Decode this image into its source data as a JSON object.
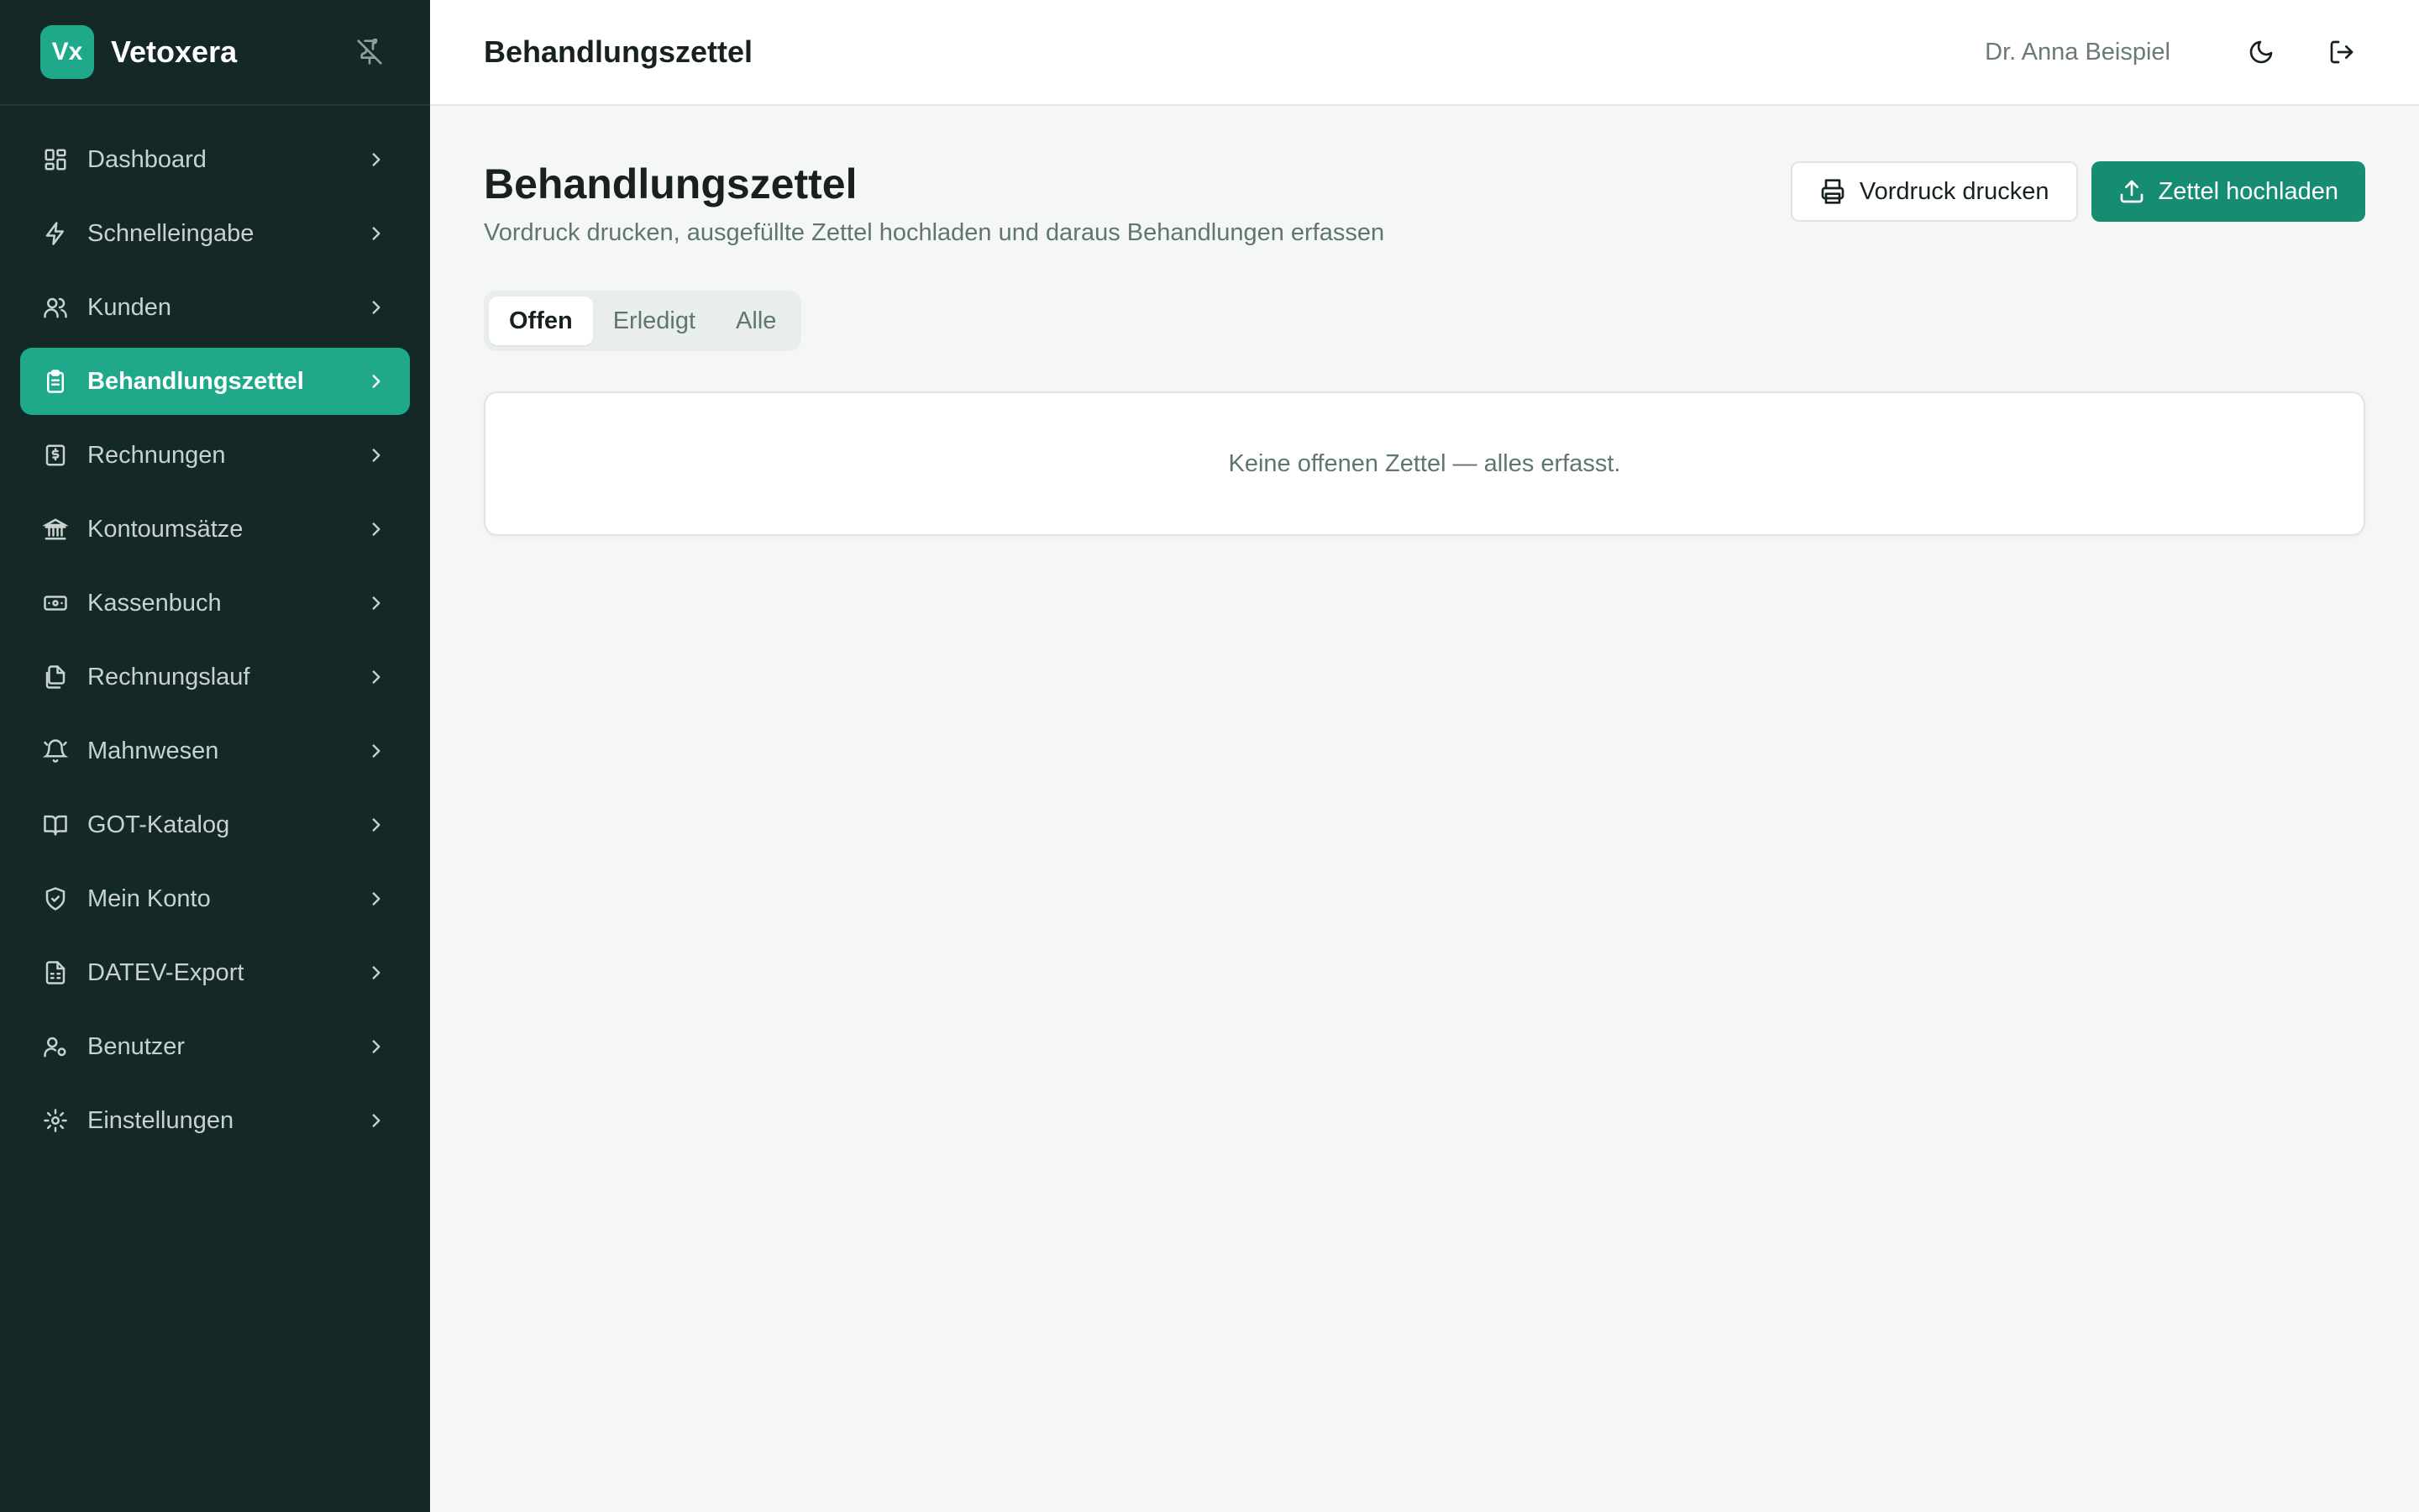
{
  "brand": {
    "logo_text": "Vx",
    "name": "Vetoxera"
  },
  "sidebar": {
    "items": [
      {
        "label": "Dashboard",
        "icon": "dashboard-icon"
      },
      {
        "label": "Schnelleingabe",
        "icon": "lightning-icon"
      },
      {
        "label": "Kunden",
        "icon": "users-icon"
      },
      {
        "label": "Behandlungszettel",
        "icon": "clipboard-icon",
        "active": true
      },
      {
        "label": "Rechnungen",
        "icon": "invoice-icon"
      },
      {
        "label": "Kontoumsätze",
        "icon": "bank-icon"
      },
      {
        "label": "Kassenbuch",
        "icon": "cash-icon"
      },
      {
        "label": "Rechnungslauf",
        "icon": "documents-icon"
      },
      {
        "label": "Mahnwesen",
        "icon": "bell-icon"
      },
      {
        "label": "GOT-Katalog",
        "icon": "book-icon"
      },
      {
        "label": "Mein Konto",
        "icon": "shield-icon"
      },
      {
        "label": "DATEV-Export",
        "icon": "spreadsheet-icon"
      },
      {
        "label": "Benutzer",
        "icon": "user-settings-icon"
      },
      {
        "label": "Einstellungen",
        "icon": "gear-icon"
      }
    ]
  },
  "topbar": {
    "title": "Behandlungszettel",
    "user": "Dr. Anna Beispiel"
  },
  "main": {
    "title": "Behandlungszettel",
    "subtitle": "Vordruck drucken, ausgefüllte Zettel hochladen und daraus Behandlungen erfassen",
    "print_button": "Vordruck drucken",
    "upload_button": "Zettel hochladen",
    "tabs": [
      {
        "label": "Offen",
        "active": true
      },
      {
        "label": "Erledigt"
      },
      {
        "label": "Alle"
      }
    ],
    "empty_message": "Keine offenen Zettel — alles erfasst."
  },
  "colors": {
    "sidebar_bg": "#142826",
    "accent": "#1fa88a",
    "primary_button": "#168d72"
  }
}
